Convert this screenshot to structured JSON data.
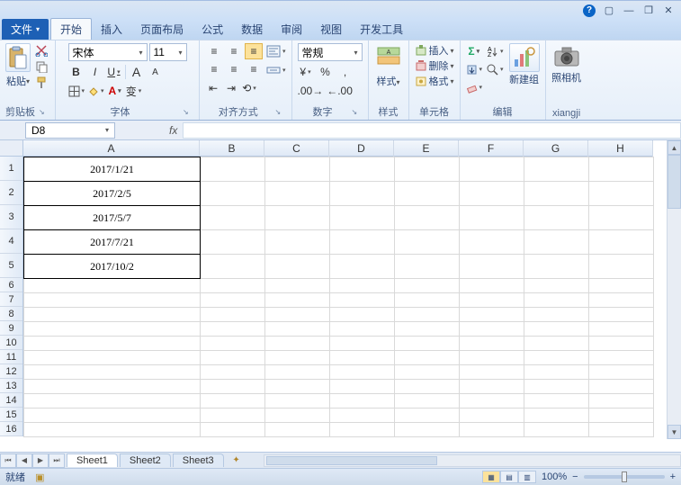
{
  "titlebar": {
    "help": "?"
  },
  "tabs": {
    "file": "文件",
    "items": [
      "开始",
      "插入",
      "页面布局",
      "公式",
      "数据",
      "审阅",
      "视图",
      "开发工具"
    ],
    "activeIndex": 0
  },
  "ribbon": {
    "clipboard": {
      "label": "剪贴板",
      "paste": "粘贴"
    },
    "font": {
      "label": "字体",
      "name": "宋体",
      "size": "11",
      "bold": "B",
      "italic": "I",
      "underline": "U",
      "growA": "A",
      "shrinkA": "A",
      "wen": "变"
    },
    "alignment": {
      "label": "对齐方式"
    },
    "number": {
      "label": "数字",
      "format": "常规",
      "percent": "%",
      "comma": ",",
      "currency": "¥"
    },
    "styles": {
      "label": "样式",
      "btn": "样式"
    },
    "cells": {
      "label": "单元格",
      "insert": "插入",
      "delete": "删除",
      "format": "格式"
    },
    "editing": {
      "label": "编辑",
      "newgroup": "新建组"
    },
    "camera": {
      "label": "xiangji",
      "btn": "照相机"
    }
  },
  "namebox": {
    "ref": "D8",
    "fx": "fx"
  },
  "columns": [
    "A",
    "B",
    "C",
    "D",
    "E",
    "F",
    "G",
    "H"
  ],
  "rows": [
    "1",
    "2",
    "3",
    "4",
    "5",
    "6",
    "7",
    "8",
    "9",
    "10",
    "11",
    "12",
    "13",
    "14",
    "15",
    "16"
  ],
  "cells": {
    "A1": "2017/1/21",
    "A2": "2017/2/5",
    "A3": "2017/5/7",
    "A4": "2017/7/21",
    "A5": "2017/10/2"
  },
  "sheets": {
    "active": "Sheet1",
    "tabs": [
      "Sheet1",
      "Sheet2",
      "Sheet3"
    ]
  },
  "status": {
    "ready": "就绪",
    "zoom": "100%",
    "minus": "−",
    "plus": "+"
  }
}
